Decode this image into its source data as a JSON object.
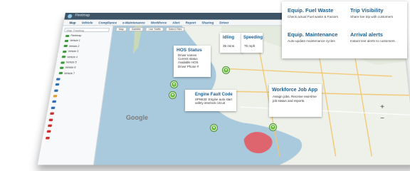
{
  "app": {
    "title": "Fleetmap",
    "nav": [
      "Map",
      "Vehicle",
      "Compliance",
      "e-Maintenance",
      "Workforce",
      "Alert",
      "Report",
      "Sharing",
      "Driver"
    ]
  },
  "sidebar": {
    "search_placeholder": "Map Tracking",
    "rows": [
      {
        "label": "Fleetmap",
        "color": "#3a9a3a"
      },
      {
        "label": "Vehicle 1",
        "color": "#3a9a3a"
      },
      {
        "label": "Vehicle 2",
        "color": "#3a9a3a"
      },
      {
        "label": "Vehicle 3",
        "color": "#3a9a3a"
      },
      {
        "label": "Vehicle 4",
        "color": "#3a9a3a"
      },
      {
        "label": "Vehicle 5",
        "color": "#3a9a3a"
      },
      {
        "label": "Vehicle 6",
        "color": "#3a9a3a"
      },
      {
        "label": "Vehicle 7",
        "color": "#3a9a3a"
      },
      {
        "label": "",
        "color": "#2f6fb0"
      },
      {
        "label": "",
        "color": "#2f6fb0"
      },
      {
        "label": "",
        "color": "#2f6fb0"
      },
      {
        "label": "",
        "color": "#e3a020"
      },
      {
        "label": "",
        "color": "#2f6fb0"
      },
      {
        "label": "",
        "color": "#2f6fb0"
      },
      {
        "label": "",
        "color": "#d0302c"
      },
      {
        "label": "",
        "color": "#d0302c"
      },
      {
        "label": "",
        "color": "#d0302c"
      },
      {
        "label": "",
        "color": "#d0302c"
      },
      {
        "label": "",
        "color": "#d0302c"
      }
    ]
  },
  "mapbar": [
    "Map",
    "Satellite",
    "Live Traffic",
    "Select Files"
  ],
  "features": {
    "fuel_waste": {
      "title": "Equip. Fuel Waste",
      "text": "Check actual Fuel waste & Factors"
    },
    "trip_visibility": {
      "title": "Trip Visibility",
      "text": "Share live trip with customers"
    },
    "maintenance": {
      "title": "Equip. Maintenance",
      "text": "Auto-update maintenance cycles"
    },
    "arrival": {
      "title": "Arrival alerts",
      "text": "Instant text alerts to customers."
    },
    "idling": {
      "title": "Idling",
      "value": "35 mins"
    },
    "speeding": {
      "title": "Speeding",
      "value": "75 mph"
    },
    "hos": {
      "title": "HOS Status",
      "lines": [
        "Driver names",
        "Current status",
        "Available HOS",
        "Driver Phone #"
      ]
    },
    "fault": {
      "title": "Engine Fault Code",
      "text": "SPN633: Engine auto start safety interlock circuit"
    },
    "job": {
      "title": "Workforce Job App",
      "text": "Assign jobs. Receive real-time job status and reports."
    }
  },
  "map": {
    "watermark": "Google",
    "zoom_in": "+",
    "zoom_out": "−"
  },
  "colors": {
    "accent": "#1f5f92",
    "pin": "#6fbf40",
    "ocean": "#9fc3d9",
    "fault_zone": "#e8525a"
  }
}
